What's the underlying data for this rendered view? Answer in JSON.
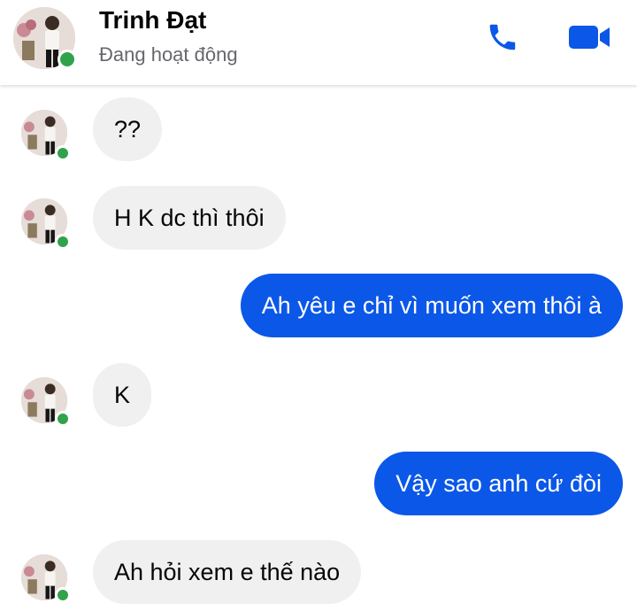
{
  "header": {
    "contact_name": "Trinh Đạt",
    "status": "Đang hoạt động",
    "call_icon": "phone-icon",
    "video_icon": "video-camera-icon"
  },
  "messages": [
    {
      "direction": "incoming",
      "text": "??"
    },
    {
      "direction": "incoming",
      "text": "H K dc thì thôi"
    },
    {
      "direction": "outgoing",
      "text": "Ah yêu e chỉ vì muốn xem thôi à"
    },
    {
      "direction": "incoming",
      "text": "K"
    },
    {
      "direction": "outgoing",
      "text": "Vậy sao anh cứ đòi"
    },
    {
      "direction": "incoming",
      "text": "Ah hỏi xem e thế nào"
    }
  ],
  "colors": {
    "accent": "#0b57e8",
    "incoming_bubble": "#f0f0f0",
    "online": "#31a24c",
    "status_text": "#65676b"
  }
}
